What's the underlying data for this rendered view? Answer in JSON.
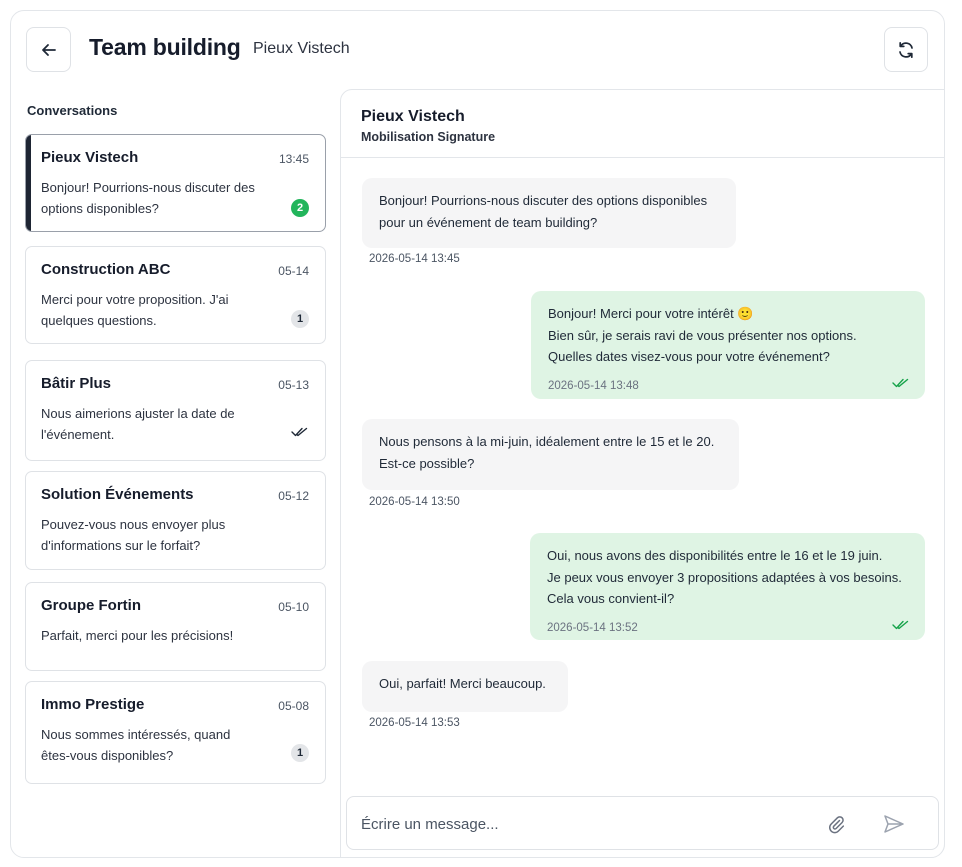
{
  "header": {
    "title": "Team building",
    "subtitle": "Pieux Vistech"
  },
  "sidebar": {
    "heading": "Conversations",
    "conversations": [
      {
        "name": "Pieux Vistech",
        "date": "13:45",
        "preview": "Bonjour! Pourrions-nous discuter des options disponibles?",
        "badge": "2",
        "status": "unread-green"
      },
      {
        "name": "Construction ABC",
        "date": "05-14",
        "preview": "Merci pour votre proposition. J'ai quelques questions.",
        "badge": "1",
        "status": "unread-gray"
      },
      {
        "name": "Bâtir Plus",
        "date": "05-13",
        "preview": "Nous aimerions ajuster la date de l'événement.",
        "badge": "",
        "status": "read"
      },
      {
        "name": "Solution Événements",
        "date": "05-12",
        "preview": "Pouvez-vous nous envoyer plus d'informations sur le forfait?",
        "badge": "",
        "status": "none"
      },
      {
        "name": "Groupe Fortin",
        "date": "05-10",
        "preview": "Parfait, merci pour les précisions!",
        "badge": "",
        "status": "none"
      },
      {
        "name": "Immo Prestige",
        "date": "05-08",
        "preview": "Nous sommes intéressés, quand êtes-vous disponibles?",
        "badge": "1",
        "status": "unread-gray"
      }
    ]
  },
  "chat": {
    "name": "Pieux Vistech",
    "subtitle": "Mobilisation Signature",
    "messages": [
      {
        "direction": "in",
        "lines": [
          "Bonjour! Pourrions-nous discuter des options disponibles",
          "pour un événement de team building?"
        ],
        "time": "2026-05-14 13:45"
      },
      {
        "direction": "out",
        "lines": [
          "Bonjour! Merci pour votre intérêt 🙂",
          "Bien sûr, je serais ravi de vous présenter nos options.",
          "Quelles dates visez-vous pour votre événement?"
        ],
        "time": "2026-05-14 13:48"
      },
      {
        "direction": "in",
        "lines": [
          "Nous pensons à la mi-juin, idéalement entre le 15 et le 20.",
          "Est-ce possible?"
        ],
        "time": "2026-05-14 13:50"
      },
      {
        "direction": "out",
        "lines": [
          "Oui, nous avons des disponibilités entre le 16 et le 19 juin.",
          "Je peux vous envoyer 3 propositions adaptées à vos besoins.",
          "Cela vous convient-il?"
        ],
        "time": "2026-05-14 13:52"
      },
      {
        "direction": "in",
        "lines": [
          "Oui, parfait! Merci beaucoup."
        ],
        "time": "2026-05-14 13:53"
      }
    ]
  },
  "composer": {
    "placeholder": "Écrire un message..."
  },
  "colors": {
    "accent_dark": "#1e2533",
    "unread_green": "#22b55b",
    "outgoing_bubble": "#dff4e4",
    "incoming_bubble": "#f5f5f6",
    "read_ticks": "#16a34a"
  },
  "icons": {
    "back": "arrow-left-icon",
    "refresh": "refresh-icon",
    "read": "double-check-icon",
    "attach": "paperclip-icon",
    "send": "send-icon"
  }
}
